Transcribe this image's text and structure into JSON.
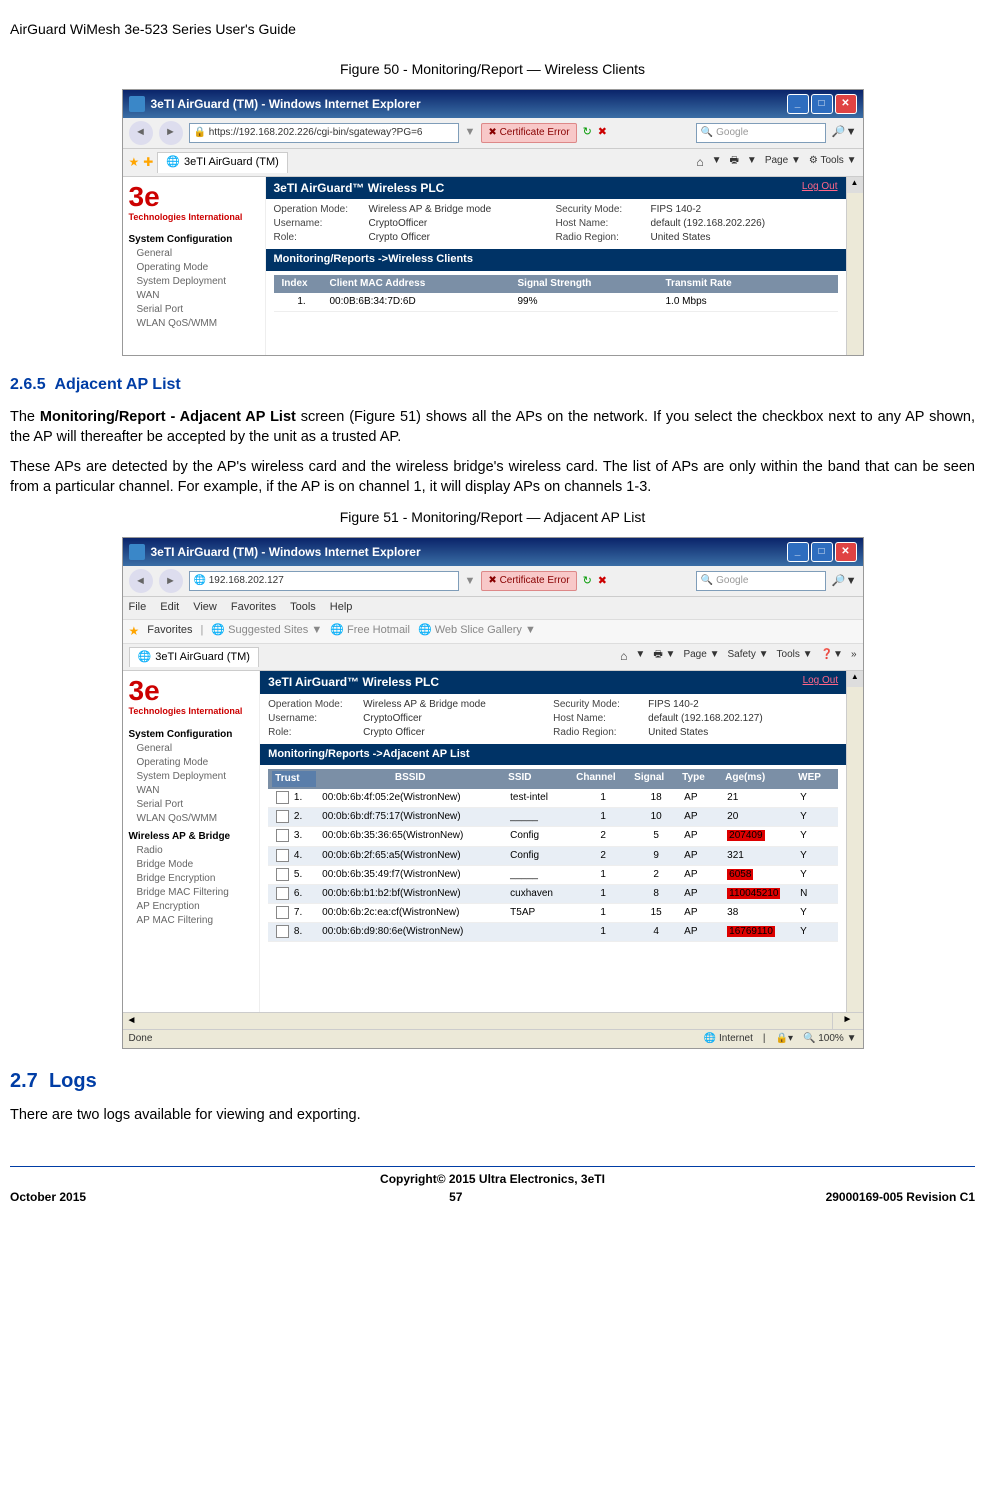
{
  "doc": {
    "header": "AirGuard WiMesh 3e-523 Series User's Guide",
    "fig50_caption": "Figure 50 - Monitoring/Report — Wireless Clients",
    "fig51_caption": "Figure 51 - Monitoring/Report — Adjacent AP List",
    "sec265_num": "2.6.5",
    "sec265_title": "Adjacent AP List",
    "para1a": "The ",
    "para1b": "Monitoring/Report - Adjacent AP List",
    "para1c": " screen (Figure 51) shows all the APs on the network. If you select the checkbox next to any AP shown, the AP will thereafter be accepted by the unit as a trusted AP.",
    "para2": "These APs are detected by the AP's wireless card and the wireless bridge's wireless card. The list of APs are only within the band that can be seen from a particular channel. For example, if the AP is on channel 1, it will display APs on channels 1-3.",
    "sec27_num": "2.7",
    "sec27_title": "Logs",
    "para3": "There are two logs available for viewing and exporting.",
    "copyright": "Copyright© 2015 Ultra Electronics, 3eTI",
    "footer_left": "October 2015",
    "footer_center": "57",
    "footer_right": "29000169-005 Revision C1"
  },
  "shot1": {
    "title": "3eTI AirGuard (TM) - Windows Internet Explorer",
    "url": "https://192.168.202.226/cgi-bin/sgateway?PG=6",
    "cert_error": "Certificate Error",
    "search_placeholder": "Google",
    "tab_name": "3eTI AirGuard (TM)",
    "tools": {
      "page": "Page",
      "tools": "Tools"
    },
    "logo_text": "Technologies International",
    "nav_section": "System Configuration",
    "nav_items": [
      "General",
      "Operating Mode",
      "System Deployment",
      "WAN",
      "Serial Port",
      "WLAN QoS/WMM"
    ],
    "panel_title": "3eTI AirGuard™ Wireless PLC",
    "logout": "Log Out",
    "info": {
      "op_mode_label": "Operation Mode:",
      "op_mode": "Wireless AP & Bridge mode",
      "user_label": "Username:",
      "user": "CryptoOfficer",
      "role_label": "Role:",
      "role": "Crypto Officer",
      "sec_label": "Security Mode:",
      "sec": "FIPS 140-2",
      "host_label": "Host Name:",
      "host": "default (192.168.202.226)",
      "region_label": "Radio Region:",
      "region": "United States"
    },
    "section_title": "Monitoring/Reports ->Wireless Clients",
    "table": {
      "headers": {
        "index": "Index",
        "mac": "Client MAC Address",
        "signal": "Signal Strength",
        "rate": "Transmit Rate"
      },
      "rows": [
        {
          "index": "1.",
          "mac": "00:0B:6B:34:7D:6D",
          "signal": "99%",
          "rate": "1.0 Mbps"
        }
      ]
    }
  },
  "shot2": {
    "title": "3eTI AirGuard (TM) - Windows Internet Explorer",
    "url": "192.168.202.127",
    "cert_error": "Certificate Error",
    "search_placeholder": "Google",
    "menu": [
      "File",
      "Edit",
      "View",
      "Favorites",
      "Tools",
      "Help"
    ],
    "fav_label": "Favorites",
    "suggested": "Suggested Sites",
    "free_hotmail": "Free Hotmail",
    "web_slice": "Web Slice Gallery",
    "tab_name": "3eTI AirGuard (TM)",
    "tools": {
      "page": "Page",
      "safety": "Safety",
      "tools": "Tools"
    },
    "logo_text": "Technologies International",
    "nav_section1": "System Configuration",
    "nav_items1": [
      "General",
      "Operating Mode",
      "System Deployment",
      "WAN",
      "Serial Port",
      "WLAN QoS/WMM"
    ],
    "nav_section2": "Wireless AP & Bridge",
    "nav_items2": [
      "Radio",
      "Bridge Mode",
      "Bridge Encryption",
      "Bridge MAC Filtering",
      "AP Encryption",
      "AP MAC Filtering"
    ],
    "panel_title": "3eTI AirGuard™ Wireless PLC",
    "logout": "Log Out",
    "info": {
      "op_mode_label": "Operation Mode:",
      "op_mode": "Wireless AP & Bridge mode",
      "user_label": "Username:",
      "user": "CryptoOfficer",
      "role_label": "Role:",
      "role": "Crypto Officer",
      "sec_label": "Security Mode:",
      "sec": "FIPS 140-2",
      "host_label": "Host Name:",
      "host": "default (192.168.202.127)",
      "region_label": "Radio Region:",
      "region": "United States"
    },
    "section_title": "Monitoring/Reports ->Adjacent AP List",
    "table": {
      "headers": {
        "trust": "Trust",
        "bssid": "BSSID",
        "ssid": "SSID",
        "channel": "Channel",
        "signal": "Signal",
        "type": "Type",
        "age": "Age(ms)",
        "wep": "WEP"
      },
      "rows": [
        {
          "n": "1.",
          "bssid": "00:0b:6b:4f:05:2e(WistronNew)",
          "ssid": "test-intel",
          "channel": "1",
          "signal": "18",
          "type": "AP",
          "age": "21",
          "age_red": false,
          "wep": "Y"
        },
        {
          "n": "2.",
          "bssid": "00:0b:6b:df:75:17(WistronNew)",
          "ssid": "_____",
          "channel": "1",
          "signal": "10",
          "type": "AP",
          "age": "20",
          "age_red": false,
          "wep": "Y"
        },
        {
          "n": "3.",
          "bssid": "00:0b:6b:35:36:65(WistronNew)",
          "ssid": "Config",
          "channel": "2",
          "signal": "5",
          "type": "AP",
          "age": "207409",
          "age_red": true,
          "wep": "Y"
        },
        {
          "n": "4.",
          "bssid": "00:0b:6b:2f:65:a5(WistronNew)",
          "ssid": "Config",
          "channel": "2",
          "signal": "9",
          "type": "AP",
          "age": "321",
          "age_red": false,
          "wep": "Y"
        },
        {
          "n": "5.",
          "bssid": "00:0b:6b:35:49:f7(WistronNew)",
          "ssid": "_____",
          "channel": "1",
          "signal": "2",
          "type": "AP",
          "age": "6058",
          "age_red": true,
          "wep": "Y"
        },
        {
          "n": "6.",
          "bssid": "00:0b:6b:b1:b2:bf(WistronNew)",
          "ssid": "cuxhaven",
          "channel": "1",
          "signal": "8",
          "type": "AP",
          "age": "110045210",
          "age_red": true,
          "wep": "N"
        },
        {
          "n": "7.",
          "bssid": "00:0b:6b:2c:ea:cf(WistronNew)",
          "ssid": "T5AP",
          "channel": "1",
          "signal": "15",
          "type": "AP",
          "age": "38",
          "age_red": false,
          "wep": "Y"
        },
        {
          "n": "8.",
          "bssid": "00:0b:6b:d9:80:6e(WistronNew)",
          "ssid": "",
          "channel": "1",
          "signal": "4",
          "type": "AP",
          "age": "16769110",
          "age_red": true,
          "wep": "Y"
        }
      ]
    },
    "status": {
      "done": "Done",
      "internet": "Internet",
      "zoom": "100%"
    }
  }
}
